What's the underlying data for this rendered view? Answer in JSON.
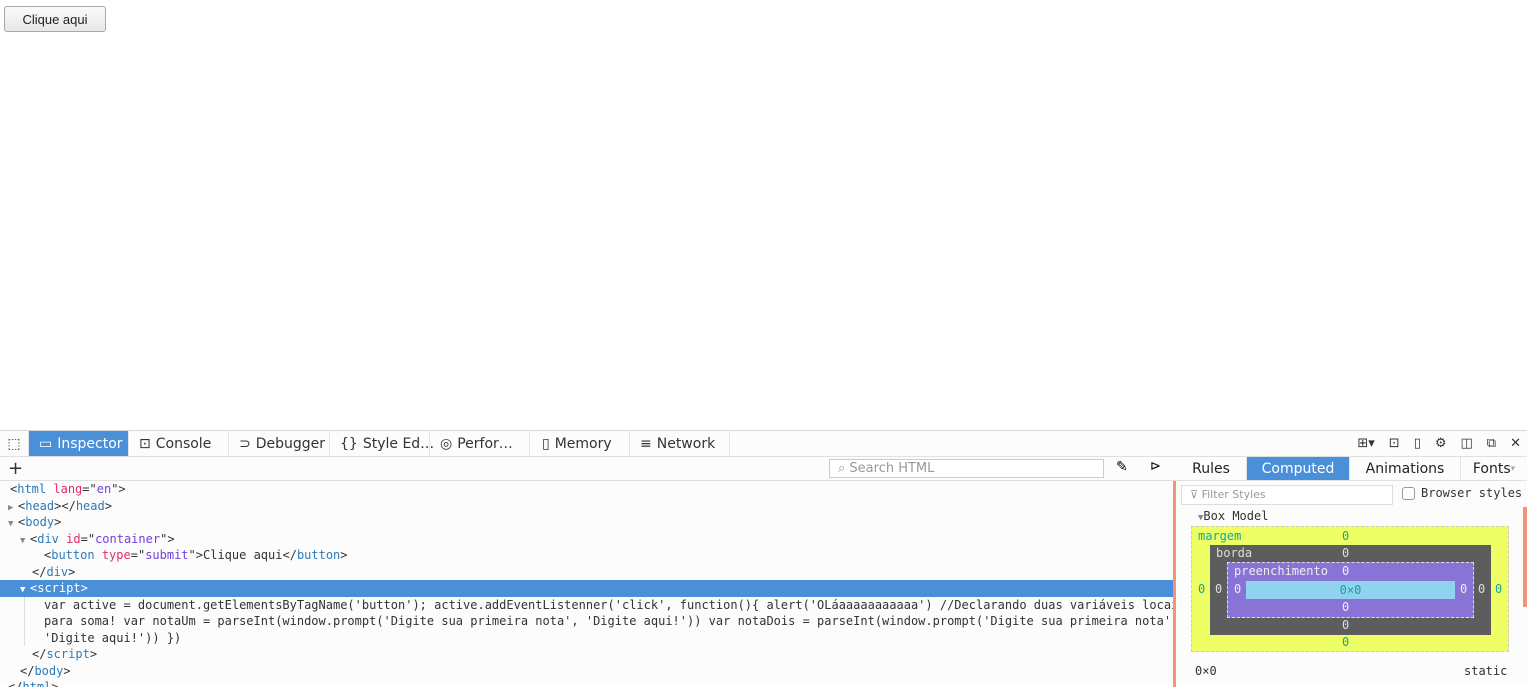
{
  "page": {
    "button_label": "Clique aqui"
  },
  "toolbar": {
    "tabs": [
      {
        "label": "Inspector",
        "icon": "inspector-icon"
      },
      {
        "label": "Console",
        "icon": "console-icon"
      },
      {
        "label": "Debugger",
        "icon": "debugger-icon"
      },
      {
        "label": "Style Ed…",
        "icon": "braces-icon"
      },
      {
        "label": "Perfor…",
        "icon": "performance-icon"
      },
      {
        "label": "Memory",
        "icon": "memory-icon"
      },
      {
        "label": "Network",
        "icon": "network-icon"
      }
    ]
  },
  "inspector": {
    "search_placeholder": "Search HTML",
    "markup": {
      "html_open": "html",
      "lang_attr": "lang",
      "lang_val": "en",
      "head": "head",
      "body": "body",
      "div": "div",
      "id_attr": "id",
      "id_val": "container",
      "button": "button",
      "type_attr": "type",
      "type_val": "submit",
      "button_text": "Clique aqui",
      "script": "script",
      "html_close": "html",
      "script_text": "var active = document.getElementsByTagName('button'); active.addEventListenner('click', function(){ alert('OLáaaaaaaaaaaa') //Declarando duas variáveis locais para soma! var notaUm = parseInt(window.prompt('Digite sua primeira nota', 'Digite aqui!')) var notaDois = parseInt(window.prompt('Digite sua primeira nota', 'Digite aqui!')) })"
    }
  },
  "sidebar": {
    "tabs": [
      "Rules",
      "Computed",
      "Animations",
      "Fonts"
    ],
    "filter_placeholder": "Filter Styles",
    "browser_styles": "Browser styles",
    "box_model_title": "Box Model",
    "box": {
      "margin_label": "margem",
      "border_label": "borda",
      "padding_label": "preenchimento",
      "margin": {
        "top": "0",
        "right": "0",
        "bottom": "0",
        "left": "0"
      },
      "border": {
        "top": "0",
        "right": "0",
        "bottom": "0",
        "left": "0"
      },
      "padding": {
        "top": "0",
        "right": "0",
        "bottom": "0",
        "left": "0"
      },
      "content": "0×0"
    },
    "size": "0×0",
    "position": "static"
  }
}
